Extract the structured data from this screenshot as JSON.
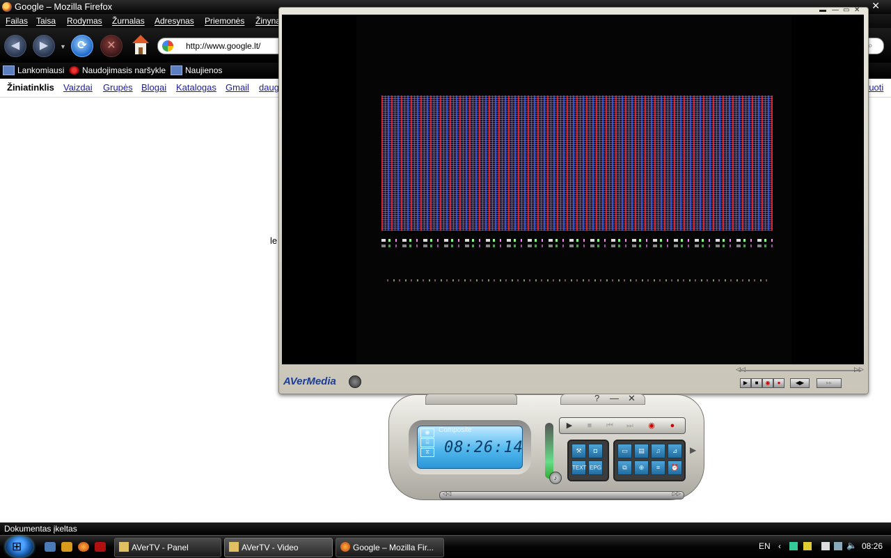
{
  "browser": {
    "window_title": "Google – Mozilla Firefox",
    "menu": [
      "Failas",
      "Taisa",
      "Rodymas",
      "Žurnalas",
      "Adresynas",
      "Priemonės",
      "Žinyna"
    ],
    "url": "http://www.google.lt/",
    "bookmarks": [
      "Lankomiausi",
      "Naudojimasis naršykle",
      "Naujienos"
    ],
    "google_nav": [
      "Žiniatinklis",
      "Vaizdai",
      "Grupės",
      "Blogai",
      "Katalogas",
      "Gmail",
      "daug"
    ],
    "google_nav_right": "ruoti",
    "page_fragment": "le",
    "status": "Dokumentas įkeltas"
  },
  "video_window": {
    "brand": "AVerMedia"
  },
  "panel": {
    "help": "?",
    "minimize": "—",
    "close": "✕",
    "source": "Composite",
    "time": "08:26:14",
    "transport": [
      "▶",
      "■",
      "⏮",
      "⏭",
      "◉",
      "●"
    ],
    "tools": [
      "TEXT",
      "EPG"
    ]
  },
  "taskbar": {
    "tasks": [
      "AVerTV - Panel",
      "AVerTV - Video",
      "Google – Mozilla Fir..."
    ],
    "language": "EN",
    "clock": "08:26"
  },
  "colors": {
    "lcd": "#52b8ee",
    "avermedia_blue": "#1a3d9a",
    "link": "#1a1aa6",
    "record": "#d10000"
  }
}
